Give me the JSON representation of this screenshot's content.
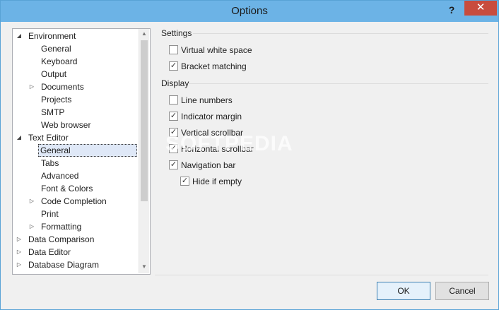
{
  "window": {
    "title": "Options",
    "help_label": "?",
    "close_label": "✕"
  },
  "tree": {
    "items": [
      {
        "label": "Environment",
        "expanded": true
      },
      {
        "label": "General"
      },
      {
        "label": "Keyboard"
      },
      {
        "label": "Output"
      },
      {
        "label": "Documents",
        "expanded": false
      },
      {
        "label": "Projects"
      },
      {
        "label": "SMTP"
      },
      {
        "label": "Web browser"
      },
      {
        "label": "Text Editor",
        "expanded": true
      },
      {
        "label": "General",
        "selected": true
      },
      {
        "label": "Tabs"
      },
      {
        "label": "Advanced"
      },
      {
        "label": "Font & Colors"
      },
      {
        "label": "Code Completion",
        "expanded": false
      },
      {
        "label": "Print"
      },
      {
        "label": "Formatting",
        "expanded": false
      },
      {
        "label": "Data Comparison",
        "expanded": false
      },
      {
        "label": "Data Editor",
        "expanded": false
      },
      {
        "label": "Database Diagram",
        "expanded": false
      }
    ],
    "scroll_up_icon": "scroll-up-arrow",
    "scroll_down_icon": "scroll-down-arrow"
  },
  "settings": {
    "title": "Settings",
    "options": [
      {
        "label": "Virtual white space",
        "checked": false
      },
      {
        "label": "Bracket matching",
        "checked": true
      }
    ]
  },
  "display": {
    "title": "Display",
    "options": [
      {
        "label": "Line numbers",
        "checked": false
      },
      {
        "label": "Indicator margin",
        "checked": true
      },
      {
        "label": "Vertical scrollbar",
        "checked": true
      },
      {
        "label": "Horizontal scrollbar",
        "checked": true
      },
      {
        "label": "Navigation bar",
        "checked": true
      },
      {
        "label": "Hide if empty",
        "checked": true
      }
    ]
  },
  "watermark": "SOFTPEDIA",
  "buttons": {
    "ok_label": "OK",
    "cancel_label": "Cancel"
  },
  "colors": {
    "titlebar": "#6cb3e6",
    "close": "#c84c3d",
    "selection": "#dfe8f7"
  }
}
